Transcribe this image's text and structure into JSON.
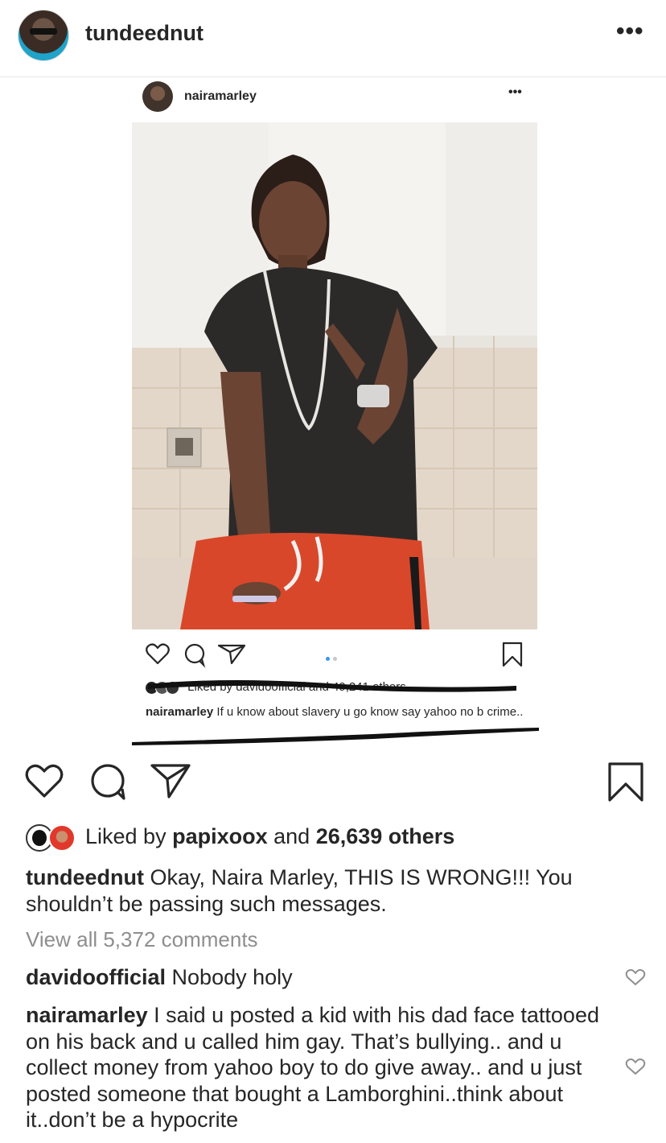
{
  "header": {
    "username": "tundeednut",
    "more": "•••"
  },
  "embedded_post": {
    "username": "nairamarley",
    "more": "•••",
    "liked_text": "Liked by davidoofficial and 49,241 others",
    "caption_user": "nairamarley",
    "caption_text": "If u know about slavery u go know say yahoo no b crime..",
    "carousel_dots": 2,
    "carousel_active_color": "#3897f0"
  },
  "actions": {
    "like_icon": "heart-icon",
    "comment_icon": "comment-icon",
    "share_icon": "share-icon",
    "save_icon": "bookmark-icon"
  },
  "likes": {
    "prefix": "Liked by",
    "user": "papixoox",
    "joiner": "and",
    "count_text": "26,639 others"
  },
  "caption": {
    "user": "tundeednut",
    "text": "Okay, Naira Marley, THIS IS WRONG!!! You shouldn’t be passing such messages."
  },
  "view_all": "View all 5,372 comments",
  "comments": [
    {
      "user": "davidoofficial",
      "text": "Nobody holy"
    },
    {
      "user": "nairamarley",
      "text": "I said u posted a kid with his dad face tattooed on his back and u called him gay. That’s bullying.. and u collect money from yahoo boy to do give away.. and u just posted someone that bought a Lamborghini..think about it..don’t be a hypocrite"
    }
  ],
  "colors": {
    "text": "#262626",
    "muted": "#8e8e8e",
    "divider": "#e6e6e6"
  }
}
